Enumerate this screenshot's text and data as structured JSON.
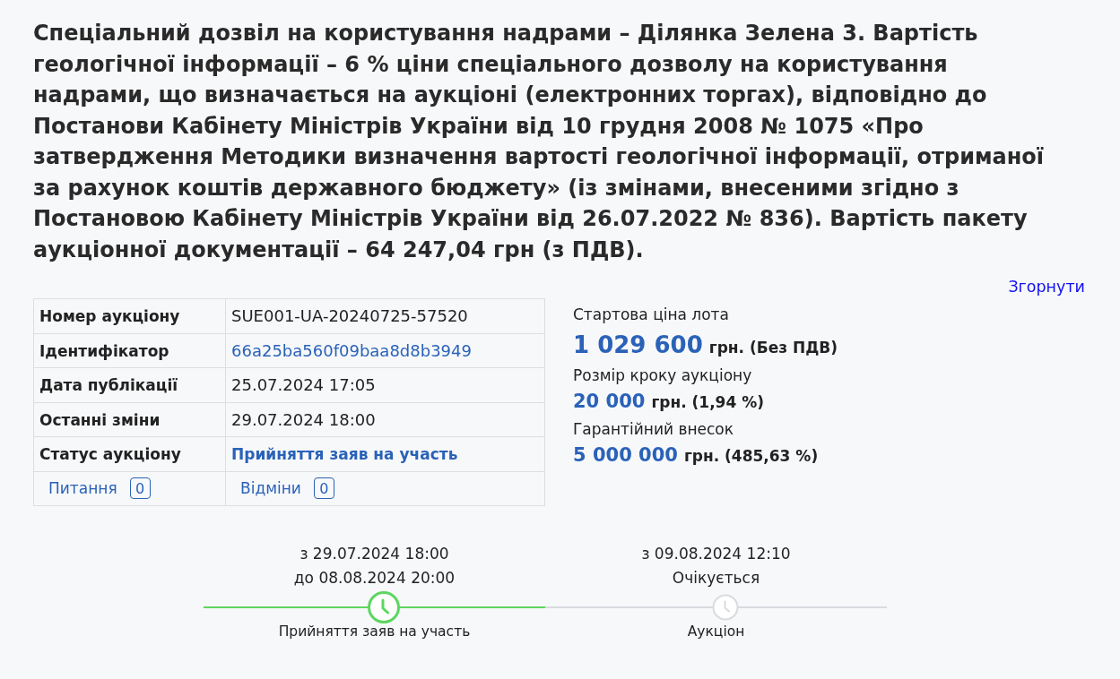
{
  "description": "Спеціальний дозвіл на користування надрами – Ділянка Зелена 3. Вартість геологічної інформації – 6 % ціни спеціального дозволу на користування надрами, що визначається на аукціоні (електронних торгах), відповідно до Постанови Кабінету Міністрів України від 10 грудня 2008 № 1075 «Про затвердження Методики визначення вартості геологічної інформації, отриманої за рахунок коштів державного бюджету» (із змінами, внесеними згідно з Постановою Кабінету Міністрів України від 26.07.2022 № 836). Вартість пакету аукціонної документації – 64 247,04 грн (з ПДВ).",
  "collapse_link": "Згорнути",
  "details_table": {
    "rows": [
      {
        "label": "Номер аукціону",
        "value": "SUE001-UA-20240725-57520",
        "kind": "text"
      },
      {
        "label": "Ідентифікатор",
        "value": "66a25ba560f09baa8d8b3949",
        "kind": "link"
      },
      {
        "label": "Дата публікації",
        "value": "25.07.2024 17:05",
        "kind": "text"
      },
      {
        "label": "Останні зміни",
        "value": "29.07.2024 18:00",
        "kind": "text"
      },
      {
        "label": "Статус аукціону",
        "value": "Прийняття заяв на участь",
        "kind": "status"
      }
    ],
    "counters": [
      {
        "label": "Питання",
        "count": "0"
      },
      {
        "label": "Відміни",
        "count": "0"
      }
    ]
  },
  "prices": [
    {
      "label": "Стартова ціна лота",
      "amount": "1 029 600",
      "suffix": "грн. (Без ПДВ)",
      "kind": "main"
    },
    {
      "label": "Розмір кроку аукціону",
      "amount": "20 000",
      "suffix": "грн. (1,94 %)",
      "kind": "extra"
    },
    {
      "label": "Гарантійний внесок",
      "amount": "5 000 000",
      "suffix": "грн. (485,63 %)",
      "kind": "extra"
    }
  ],
  "timeline": {
    "stages": [
      {
        "period": [
          "з 29.07.2024 18:00",
          "до 08.08.2024 20:00"
        ],
        "name": "Прийняття заяв на участь",
        "active": true
      },
      {
        "period": [
          "з 09.08.2024 12:10",
          "Очікується"
        ],
        "name": "Аукціон",
        "active": false
      }
    ]
  }
}
